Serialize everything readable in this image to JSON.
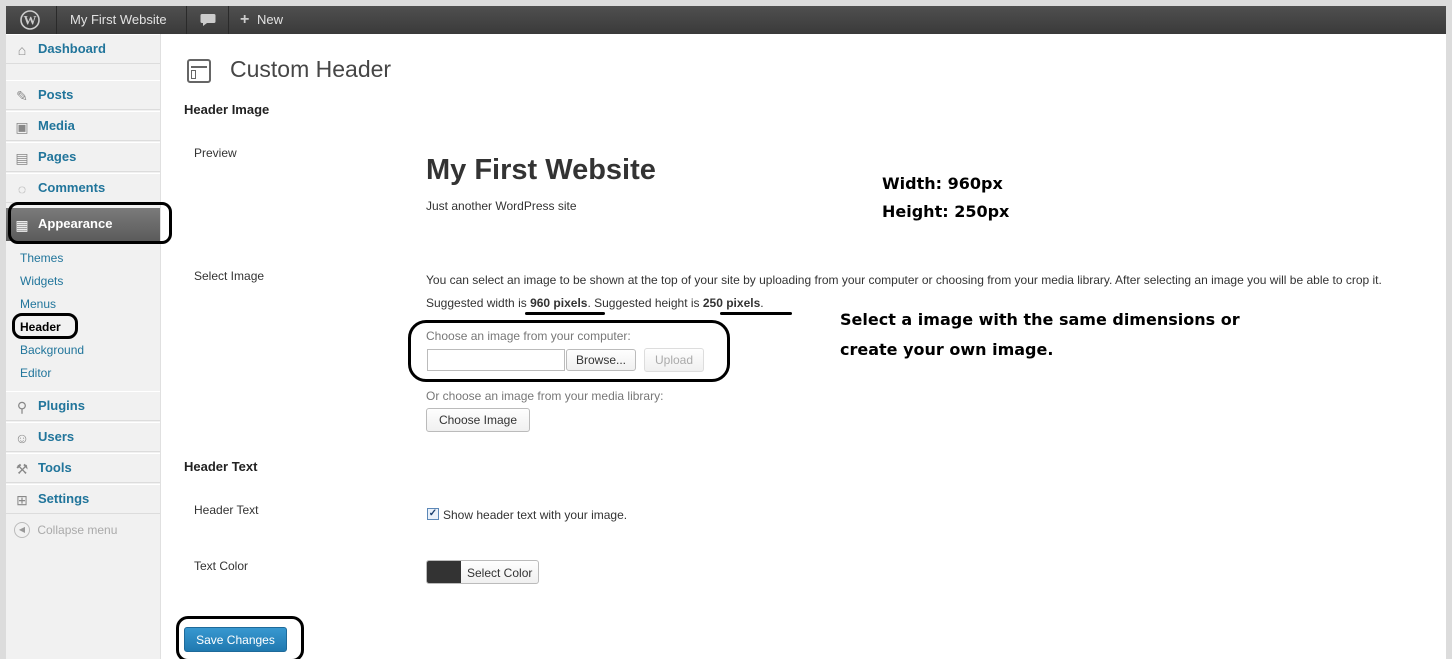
{
  "admin_bar": {
    "site_name": "My First Website",
    "new_label": "New"
  },
  "sidebar": {
    "items": [
      {
        "label": "Dashboard",
        "icon": "home-icon"
      },
      {
        "label": "Posts",
        "icon": "pin-icon"
      },
      {
        "label": "Media",
        "icon": "media-icon"
      },
      {
        "label": "Pages",
        "icon": "pages-icon"
      },
      {
        "label": "Comments",
        "icon": "comment-icon"
      },
      {
        "label": "Appearance",
        "icon": "appearance-icon"
      },
      {
        "label": "Plugins",
        "icon": "plugin-icon"
      },
      {
        "label": "Users",
        "icon": "users-icon"
      },
      {
        "label": "Tools",
        "icon": "tools-icon"
      },
      {
        "label": "Settings",
        "icon": "settings-icon"
      }
    ],
    "appearance_sub": [
      "Themes",
      "Widgets",
      "Menus",
      "Header",
      "Background",
      "Editor"
    ],
    "current_sub": "Header",
    "collapse_label": "Collapse menu"
  },
  "page": {
    "title": "Custom Header",
    "header_image_heading": "Header Image",
    "preview_label": "Preview",
    "preview_site_title": "My First Website",
    "preview_tagline": "Just another WordPress site",
    "select_image_label": "Select Image",
    "select_desc": "You can select an image to be shown at the top of your site by uploading from your computer or choosing from your media library. After selecting an image you will be able to crop it.",
    "suggested_width_prefix": "Suggested width is",
    "suggested_width": "960 pixels",
    "suggested_height_prefix": ". Suggested height is",
    "suggested_height": "250 pixels",
    "suggested_suffix": ".",
    "choose_computer_label": "Choose an image from your computer:",
    "browse_label": "Browse...",
    "upload_label": "Upload",
    "media_library_label": "Or choose an image from your media library:",
    "choose_image_label": "Choose Image",
    "header_text_heading": "Header Text",
    "header_text_label": "Header Text",
    "show_header_text": "Show header text with your image.",
    "show_header_text_checked": true,
    "text_color_label": "Text Color",
    "text_color_value": "#333333",
    "select_color_label": "Select Color",
    "save_label": "Save Changes"
  },
  "annotations": {
    "width_note": "Width: 960px",
    "height_note": "Height: 250px",
    "select_note_line1": "Select a image with the same dimensions or",
    "select_note_line2": "create your own image."
  },
  "colors": {
    "admin_bar": "#464646",
    "link": "#21759b",
    "primary_button": "#2a8bbf"
  }
}
